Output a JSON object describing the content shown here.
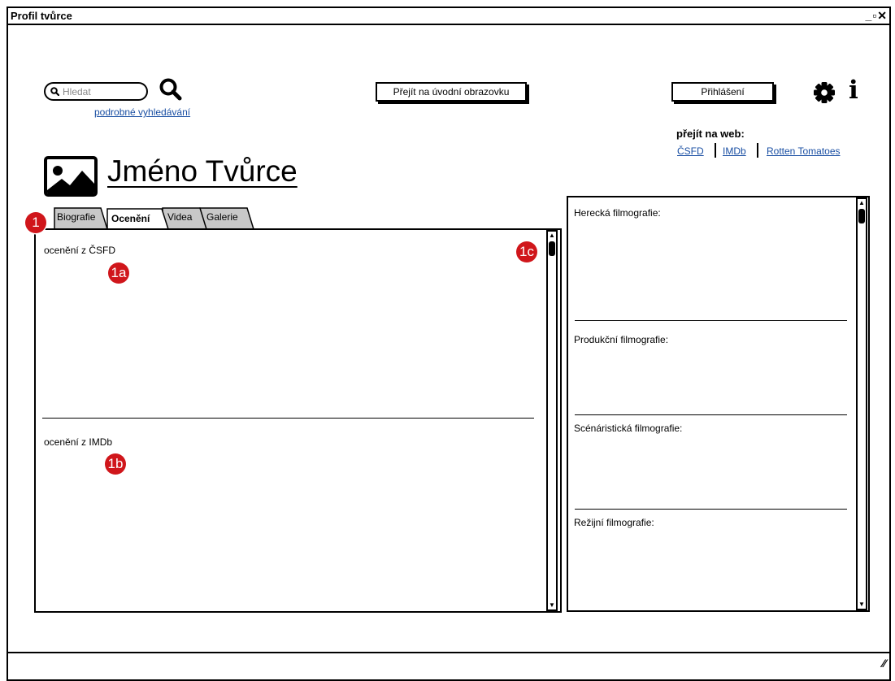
{
  "window": {
    "title": "Profil tvůrce",
    "controls": "‒▫✕"
  },
  "search": {
    "placeholder": "Hledat",
    "advanced_link": "podrobné vyhledávání"
  },
  "header": {
    "home_button": "Přejít na úvodní obrazovku",
    "login_button": "Přihlášení",
    "info_icon_glyph": "i"
  },
  "web_links": {
    "heading": "přejít na web:",
    "items": [
      "ČSFD",
      "IMDb",
      "Rotten Tomatoes"
    ]
  },
  "creator": {
    "name": "Jméno Tvůrce"
  },
  "tabs": {
    "items": [
      "Biografie",
      "Ocenění",
      "Videa",
      "Galerie"
    ],
    "active": "Ocenění"
  },
  "awards_panel": {
    "sections": [
      "ocenění z ČSFD",
      "ocenění z IMDb"
    ]
  },
  "filmography_panel": {
    "sections": [
      "Herecká filmografie:",
      "Produkční filmografie:",
      "Scénáristická filmografie:",
      "Režijní filmografie:"
    ]
  },
  "markers": [
    "1",
    "1a",
    "1b",
    "1c"
  ],
  "colors": {
    "marker_red": "#d0161b",
    "link_blue": "#1a4fa3",
    "inactive_tab": "#c8c8c8"
  }
}
